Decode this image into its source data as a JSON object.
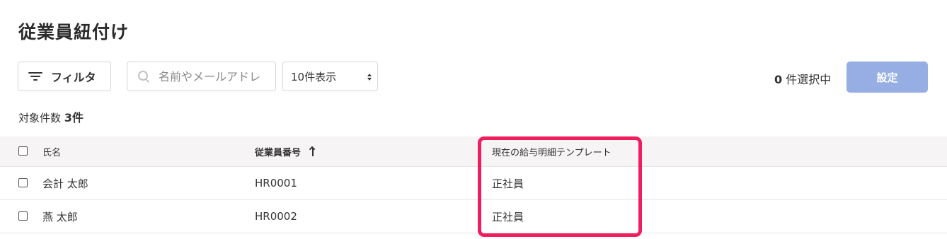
{
  "page": {
    "title": "従業員紐付け"
  },
  "toolbar": {
    "filter_label": "フィルタ",
    "search_placeholder": "名前やメールアドレ",
    "per_page_label": "10件表示",
    "selected_count_number": "0",
    "selected_count_suffix": " 件選択中",
    "set_button_label": "設定"
  },
  "summary": {
    "label": "対象件数 ",
    "count": "3件"
  },
  "table": {
    "columns": [
      {
        "label": "氏名"
      },
      {
        "label": "従業員番号",
        "sort": "ascending"
      },
      {
        "label": "現在の給与明細テンプレート"
      }
    ],
    "rows": [
      {
        "name": "会計 太郎",
        "employee_number": "HR0001",
        "template": "正社員"
      },
      {
        "name": "燕 太郎",
        "employee_number": "HR0002",
        "template": "正社員"
      }
    ]
  },
  "colors": {
    "accent_button": "#96aee3",
    "highlight": "#f01e5f",
    "header_bg": "#f6f4f4"
  }
}
